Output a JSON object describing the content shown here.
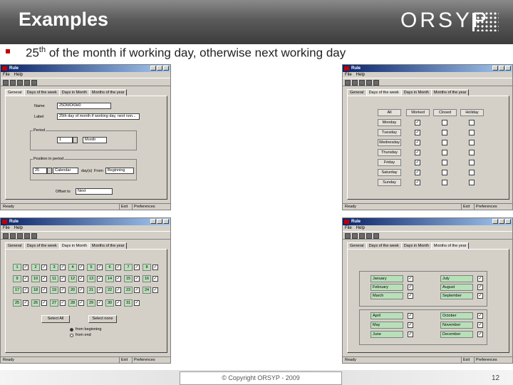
{
  "slide": {
    "title": "Examples",
    "logo": "ORSYP",
    "subtitle_pre": "25",
    "subtitle_sup": "th",
    "subtitle_post": " of the month if working day, otherwise next working day",
    "copyright": "© Copyright ORSYP - 2009",
    "page_number": "12",
    "accent_color": "#c00000"
  },
  "window_common": {
    "title": "Rule",
    "menu": [
      "File",
      "Help"
    ],
    "tabs": [
      "General",
      "Days of the week",
      "Days in Month",
      "Months of the year"
    ],
    "status_ready": "Ready",
    "status_cols": [
      "Exit",
      "Preferences"
    ]
  },
  "general_tab": {
    "name_label": "Name",
    "name_value": "25DMOI0H0",
    "label_label": "Label",
    "label_value": "25th day of month if working day, next non...",
    "period_label": "Period",
    "period_value": "1",
    "period_unit": "Month",
    "position_label": "Position in period",
    "position_value": "25",
    "position_type": "Calendar",
    "days_label": "day(s)",
    "from_label": "From",
    "from_value": "Beginning",
    "offset_label": "Offset to",
    "offset_value": "Next"
  },
  "days_of_week_tab": {
    "headers": [
      "All",
      "Worked",
      "Closed",
      "Holiday"
    ],
    "days": [
      "Monday",
      "Tuesday",
      "Wednesday",
      "Thursday",
      "Friday",
      "Saturday",
      "Sunday"
    ],
    "worked_checked": [
      true,
      true,
      true,
      true,
      true,
      true,
      true
    ]
  },
  "days_in_month_tab": {
    "days": [
      "1",
      "2",
      "3",
      "4",
      "5",
      "6",
      "7",
      "8",
      "9",
      "10",
      "11",
      "12",
      "13",
      "14",
      "15",
      "16",
      "17",
      "18",
      "19",
      "20",
      "21",
      "22",
      "23",
      "24",
      "25",
      "26",
      "27",
      "28",
      "29",
      "30",
      "31"
    ],
    "select_all": "Select All",
    "select_none": "Select none",
    "radio_beginning": "from beginning",
    "radio_end": "from end"
  },
  "months_tab": {
    "groups": [
      [
        "January",
        "February",
        "March"
      ],
      [
        "July",
        "August",
        "September"
      ],
      [
        "April",
        "May",
        "June"
      ],
      [
        "October",
        "November",
        "December"
      ]
    ]
  }
}
